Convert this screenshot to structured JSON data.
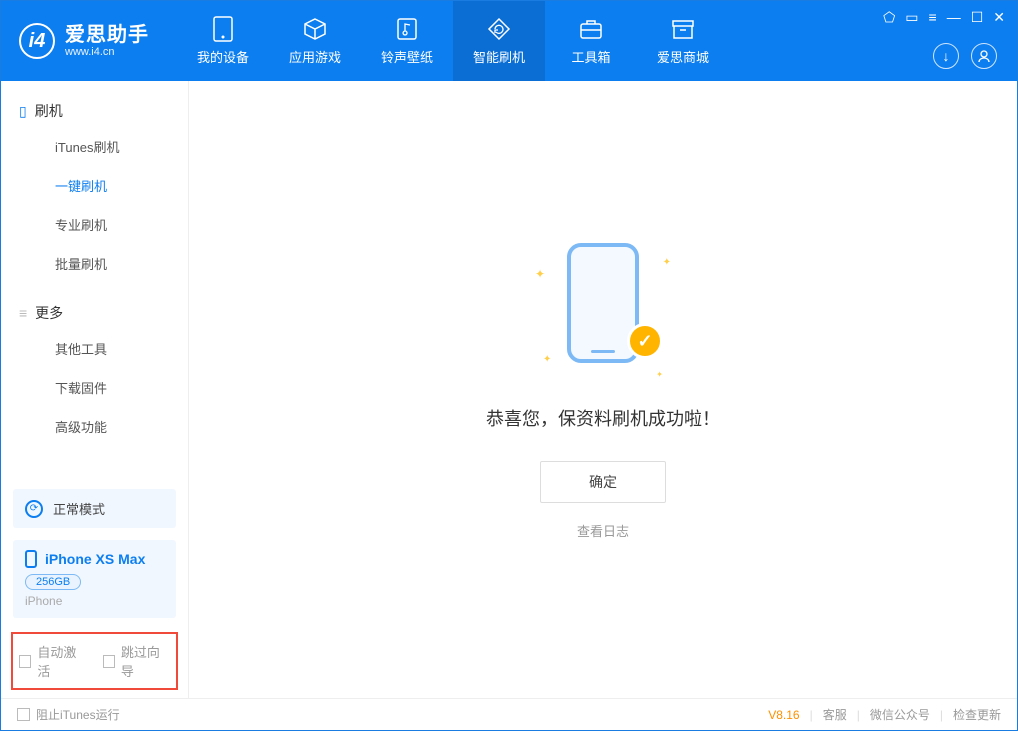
{
  "app": {
    "title": "爱思助手",
    "subtitle": "www.i4.cn"
  },
  "nav": [
    {
      "label": "我的设备",
      "icon": "device"
    },
    {
      "label": "应用游戏",
      "icon": "cube"
    },
    {
      "label": "铃声壁纸",
      "icon": "music"
    },
    {
      "label": "智能刷机",
      "icon": "refresh",
      "active": true
    },
    {
      "label": "工具箱",
      "icon": "toolbox"
    },
    {
      "label": "爱思商城",
      "icon": "store"
    }
  ],
  "sidebar": {
    "section1": {
      "title": "刷机",
      "items": [
        {
          "label": "iTunes刷机"
        },
        {
          "label": "一键刷机",
          "active": true
        },
        {
          "label": "专业刷机"
        },
        {
          "label": "批量刷机"
        }
      ]
    },
    "section2": {
      "title": "更多",
      "items": [
        {
          "label": "其他工具"
        },
        {
          "label": "下载固件"
        },
        {
          "label": "高级功能"
        }
      ]
    },
    "mode": "正常模式",
    "device": {
      "name": "iPhone XS Max",
      "capacity": "256GB",
      "type": "iPhone"
    },
    "checks": {
      "auto_activate": "自动激活",
      "skip_guide": "跳过向导"
    }
  },
  "content": {
    "message": "恭喜您，保资料刷机成功啦！",
    "ok": "确定",
    "view_log": "查看日志"
  },
  "footer": {
    "block_itunes": "阻止iTunes运行",
    "version": "V8.16",
    "support": "客服",
    "wechat": "微信公众号",
    "update": "检查更新"
  }
}
